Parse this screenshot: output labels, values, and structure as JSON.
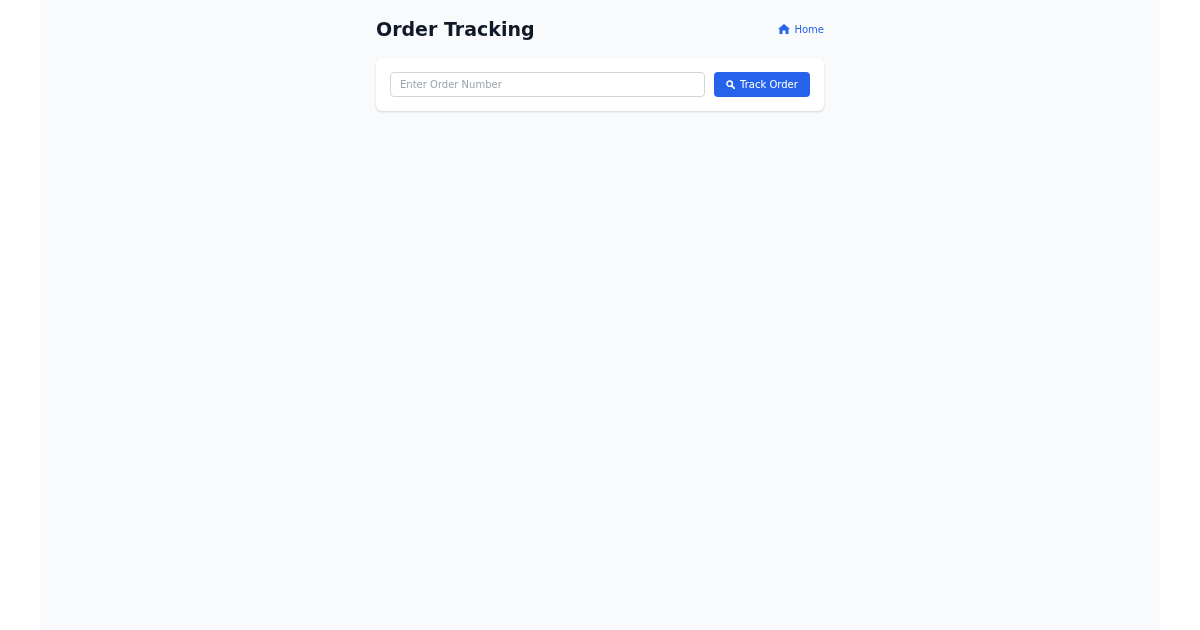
{
  "header": {
    "title": "Order Tracking",
    "home_link": "Home"
  },
  "search": {
    "placeholder": "Enter Order Number",
    "button": "Track Order"
  }
}
